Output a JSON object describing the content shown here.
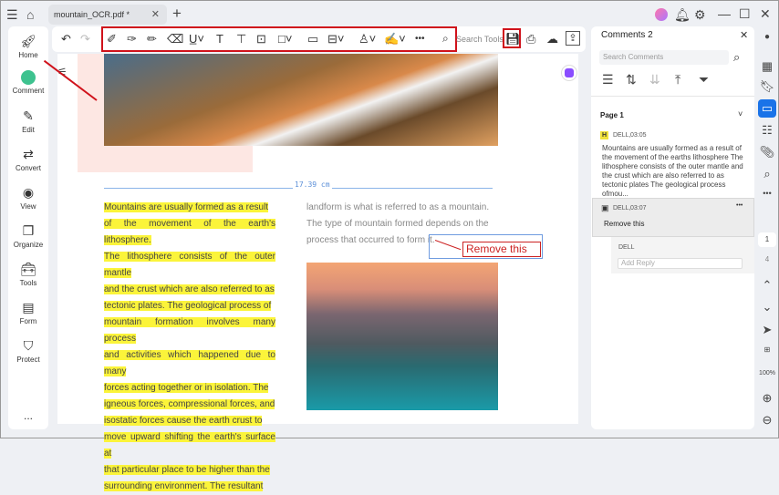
{
  "titlebar": {
    "tab_title": "mountain_OCR.pdf *"
  },
  "sidebar": {
    "items": [
      {
        "label": "Home",
        "icon": "rocket-icon"
      },
      {
        "label": "Comment",
        "icon": "comment-icon"
      },
      {
        "label": "Edit",
        "icon": "edit-icon"
      },
      {
        "label": "Convert",
        "icon": "convert-icon"
      },
      {
        "label": "View",
        "icon": "eye-icon"
      },
      {
        "label": "Organize",
        "icon": "organize-icon"
      },
      {
        "label": "Tools",
        "icon": "tools-icon"
      },
      {
        "label": "Form",
        "icon": "form-icon"
      },
      {
        "label": "Protect",
        "icon": "shield-icon"
      }
    ],
    "more": "..."
  },
  "toolbar": {
    "search_placeholder": "Search Tools",
    "more": "•••"
  },
  "document": {
    "ruler_label": "17.39 cm",
    "left_lines": [
      "Mountains are usually formed as a result",
      "of the movement of the earth's lithosphere.",
      "The lithosphere consists of the outer mantle",
      "and the crust which are also referred to as",
      "tectonic plates. The geological process of",
      "mountain formation involves many process",
      "and activities which happened due to many",
      "forces acting together or in isolation. The",
      "igneous forces, compressional forces, and",
      "isostatic forces cause the earth crust to",
      "move upward shifting the earth's surface at",
      "that particular place to be higher than the",
      "surrounding environment. The resultant"
    ],
    "right_lines": [
      "landform is what is referred to as a mountain.",
      "The type of mountain formed depends on the",
      "process that occurred to form it."
    ],
    "callout_text": "Remove this"
  },
  "comments": {
    "title": "Comments 2",
    "search_placeholder": "Search Comments",
    "page_label": "Page 1",
    "items": [
      {
        "badge": "H",
        "author": "DELL,",
        "time": "03:05",
        "text": "Mountains are usually formed as a result of the movement of the earths lithosphere The lithosphere consists of the outer mantle and the crust which are also referred to as tectonic plates The geological process ofmou..."
      },
      {
        "author": "DELL,",
        "time": "03:07",
        "text": "Remove this",
        "more": "•••"
      }
    ],
    "reply_author": "DELL",
    "reply_placeholder": "Add Reply"
  },
  "rail": {
    "page_current": "1",
    "page_total": "4",
    "zoom": "100%"
  },
  "colors": {
    "accent": "#1a73e8",
    "highlight": "#fbf43a",
    "red": "#d0121b"
  }
}
